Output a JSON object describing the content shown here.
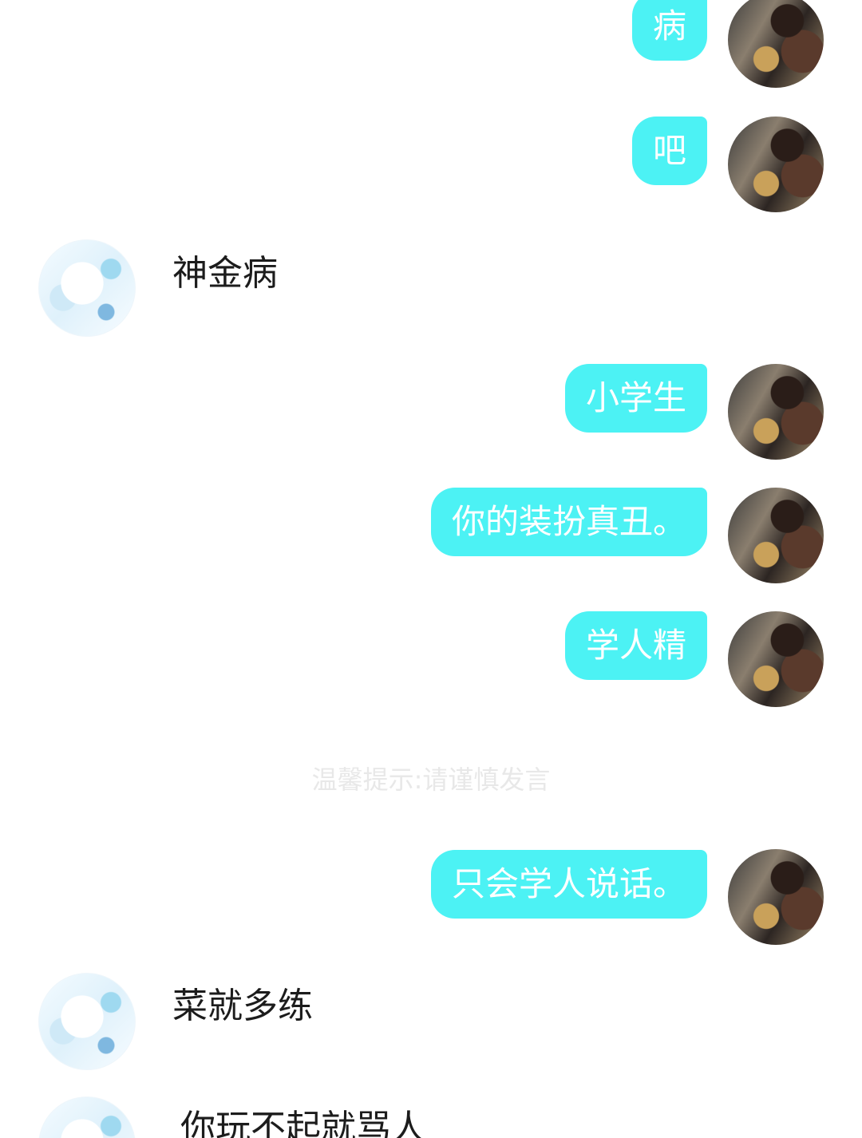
{
  "messages": [
    {
      "side": "me",
      "text": "病"
    },
    {
      "side": "me",
      "text": "吧"
    },
    {
      "side": "other",
      "text": "神金病"
    },
    {
      "side": "me",
      "text": "小学生"
    },
    {
      "side": "me",
      "text": "你的装扮真丑。"
    },
    {
      "side": "me",
      "text": "学人精"
    },
    {
      "side": "me",
      "text": "只会学人说话。"
    },
    {
      "side": "other",
      "text": "菜就多练"
    },
    {
      "side": "other",
      "text": "你玩不起就骂人"
    }
  ],
  "notice": "温馨提示:请谨慎发言",
  "colors": {
    "my_bubble": "#4cf2f4",
    "my_text": "#ffffff",
    "other_text": "#1c1c1c",
    "background": "#ffffff"
  }
}
